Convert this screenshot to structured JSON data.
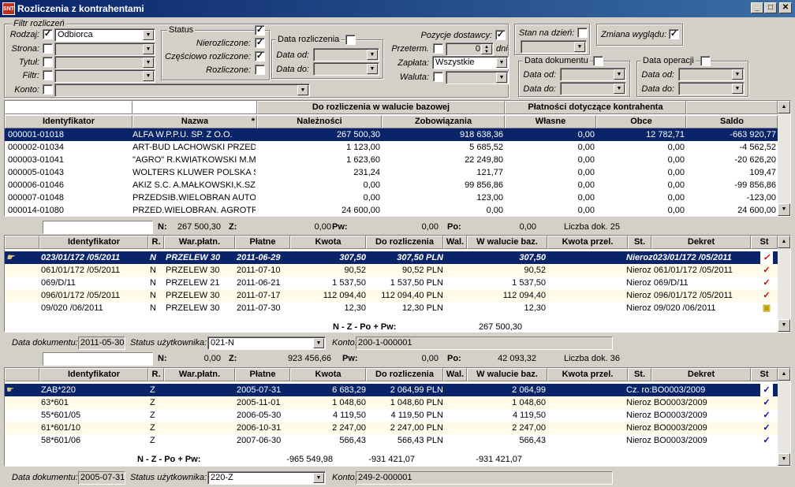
{
  "window": {
    "title": "Rozliczenia z kontrahentami",
    "app_icon": "SNT"
  },
  "filters": {
    "group_title": "Filtr rozliczeń",
    "rodzaj_label": "Rodzaj:",
    "rodzaj_value": "Odbiorca",
    "strona_label": "Strona:",
    "tytul_label": "Tytuł:",
    "filtr_label": "Filtr:",
    "konto_label": "Konto:"
  },
  "status": {
    "title": "Status",
    "nierozliczone": "Nierozliczone:",
    "czesciowo": "Częściowo rozliczone:",
    "rozliczone": "Rozliczone:"
  },
  "data_rozl": {
    "title": "Data rozliczenia",
    "od": "Data od:",
    "do": "Data do:"
  },
  "pozycje": {
    "label": "Pozycje dostawcy:",
    "przeterm": "Przeterm.",
    "dni_value": "0",
    "dni": "dni",
    "zaplata": "Zapłata:",
    "zaplata_value": "Wszystkie",
    "waluta": "Waluta:"
  },
  "stan": {
    "label": "Stan na dzień:"
  },
  "zmiana": {
    "label": "Zmiana wyglądu:"
  },
  "data_dok": {
    "title": "Data dokumentu",
    "od": "Data od:",
    "do": "Data do:"
  },
  "data_op": {
    "title": "Data operacji",
    "od": "Data od:",
    "do": "Data do:"
  },
  "t1": {
    "group1": "Do rozliczenia w walucie bazowej",
    "group2": "Płatności dotyczące kontrahenta",
    "cols": [
      "Identyfikator",
      "Nazwa",
      "Należności",
      "Zobowiązania",
      "Własne",
      "Obce",
      "Saldo"
    ],
    "rows": [
      [
        "000001-01018",
        "ALFA W.P.P.U. SP. Z O.O.",
        "267 500,30",
        "918 638,36",
        "0,00",
        "12 782,71",
        "-663 920,77"
      ],
      [
        "000002-01034",
        "ART-BUD LACHOWSKI PRZEDS",
        "1 123,00",
        "5 685,52",
        "0,00",
        "0,00",
        "-4 562,52"
      ],
      [
        "000003-01041",
        "\"AGRO\" R.KWIATKOWSKI M.MA",
        "1 623,60",
        "22 249,80",
        "0,00",
        "0,00",
        "-20 626,20"
      ],
      [
        "000005-01043",
        "WOLTERS KLUWER POLSKA SP",
        "231,24",
        "121,77",
        "0,00",
        "0,00",
        "109,47"
      ],
      [
        "000006-01046",
        "AKIZ  S.C. A.MAŁKOWSKI,K.SZ",
        "0,00",
        "99 856,86",
        "0,00",
        "0,00",
        "-99 856,86"
      ],
      [
        "000007-01048",
        "PRZEDSIB.WIELOBRAN AUTO-E",
        "0,00",
        "123,00",
        "0,00",
        "0,00",
        "-123,00"
      ],
      [
        "000014-01080",
        "PRZED.WIELOBRAN. AGROTRA",
        "24 600,00",
        "0,00",
        "0,00",
        "0,00",
        "24 600,00"
      ]
    ]
  },
  "s2": {
    "n_label": "N:",
    "n": "267 500,30",
    "z_label": "Z:",
    "z": "0,00",
    "pw_label": "Pw:",
    "pw": "0,00",
    "po_label": "Po:",
    "po": "0,00",
    "liczba": "Liczba dok. 25"
  },
  "t2": {
    "cols": [
      "Identyfikator",
      "R.",
      "War.płatn.",
      "Płatne",
      "Kwota",
      "Do rozliczenia",
      "Wal.",
      "W walucie baz.",
      "Kwota przel.",
      "St.",
      "Dekret",
      "St"
    ],
    "rows": [
      [
        "023/01/172 /05/2011",
        "N",
        "PRZELEW 30",
        "2011-06-29",
        "307,50",
        "307,50 PLN",
        "307,50",
        "Nieroz023/01/172 /05/2011"
      ],
      [
        "061/01/172 /05/2011",
        "N",
        "PRZELEW 30",
        "2011-07-10",
        "90,52",
        "90,52 PLN",
        "90,52",
        "Nieroz 061/01/172 /05/2011"
      ],
      [
        "069/D/11",
        "N",
        "PRZELEW 21",
        "2011-06-21",
        "1 537,50",
        "1 537,50 PLN",
        "1 537,50",
        "Nieroz 069/D/11"
      ],
      [
        "096/01/172 /05/2011",
        "N",
        "PRZELEW 30",
        "2011-07-17",
        "112 094,40",
        "112 094,40 PLN",
        "112 094,40",
        "Nieroz 096/01/172 /05/2011"
      ],
      [
        "09/020 /06/2011",
        "N",
        "PRZELEW 30",
        "2011-07-30",
        "12,30",
        "12,30 PLN",
        "12,30",
        "Nieroz 09/020 /06/2011"
      ]
    ],
    "sum_label": "N - Z - Po + Pw:",
    "sum_value": "267 500,30"
  },
  "f2": {
    "data_label": "Data dokumentu:",
    "data": "2011-05-30",
    "status_label": "Status użytkownika:",
    "status": "021-N",
    "konto_label": "Konto:",
    "konto": "200-1-000001"
  },
  "s3": {
    "n_label": "N:",
    "n": "0,00",
    "z_label": "Z:",
    "z": "923 456,66",
    "pw_label": "Pw:",
    "pw": "0,00",
    "po_label": "Po:",
    "po": "42 093,32",
    "liczba": "Liczba dok. 36"
  },
  "t3": {
    "rows": [
      [
        "ZAB*220",
        "Z",
        "",
        "2005-07-31",
        "6 683,29",
        "2 064,99 PLN",
        "2 064,99",
        "Cz. ro:BO0003/2009"
      ],
      [
        "63*601",
        "Z",
        "",
        "2005-11-01",
        "1 048,60",
        "1 048,60 PLN",
        "1 048,60",
        "Nieroz BO0003/2009"
      ],
      [
        "55*601/05",
        "Z",
        "",
        "2006-05-30",
        "4 119,50",
        "4 119,50 PLN",
        "4 119,50",
        "Nieroz BO0003/2009"
      ],
      [
        "61*601/10",
        "Z",
        "",
        "2006-10-31",
        "2 247,00",
        "2 247,00 PLN",
        "2 247,00",
        "Nieroz BO0003/2009"
      ],
      [
        "58*601/06",
        "Z",
        "",
        "2007-06-30",
        "566,43",
        "566,43 PLN",
        "566,43",
        "Nieroz BO0003/2009"
      ]
    ],
    "sum_label": "N - Z - Po + Pw:",
    "sum1": "-965 549,98",
    "sum2": "-931 421,07",
    "sum3": "-931 421,07"
  },
  "f3": {
    "data_label": "Data dokumentu:",
    "data": "2005-07-31",
    "status_label": "Status użytkownika:",
    "status": "220-Z",
    "konto_label": "Konto:",
    "konto": "249-2-000001"
  },
  "colors": {
    "selection": "#0a246a",
    "titlebar": "#0a246a",
    "check_red": "#cc0000",
    "check_blue": "#0000cc"
  }
}
